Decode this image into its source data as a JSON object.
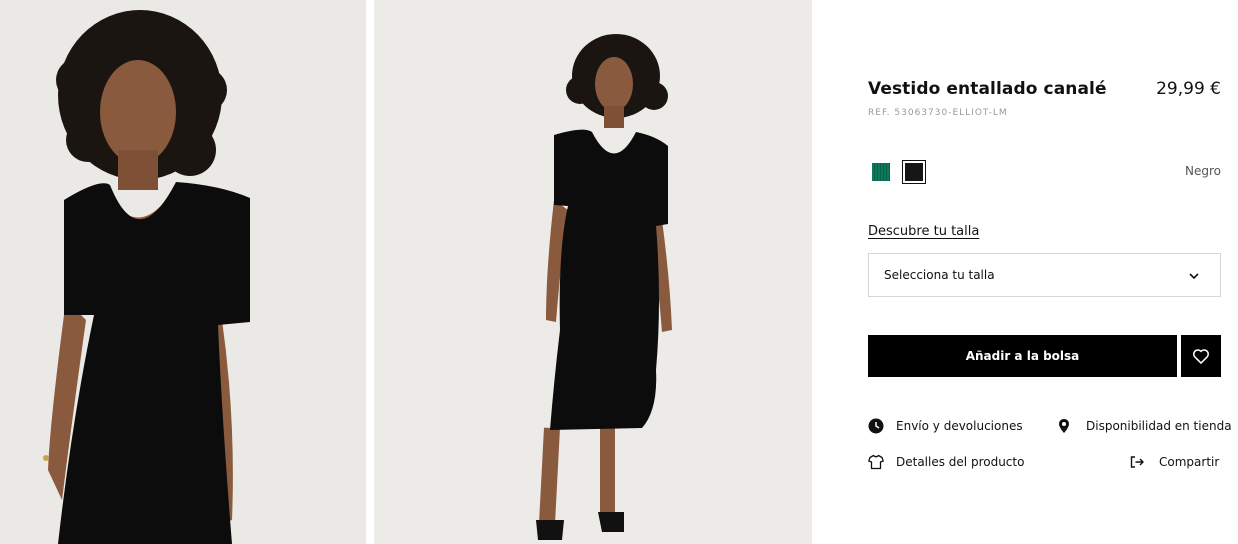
{
  "product": {
    "title": "Vestido entallado canalé",
    "price": "29,99 €",
    "reference": "REF. 53063730-ELLIOT-LM",
    "selected_color": "Negro",
    "colors": [
      {
        "name": "green-swatch",
        "hex": "#0b7a5d"
      },
      {
        "name": "black-swatch",
        "hex": "#161616"
      }
    ]
  },
  "size": {
    "guide_link": "Descubre tu talla",
    "select_label": "Selecciona tu talla"
  },
  "actions": {
    "add_to_bag": "Añadir a la bolsa"
  },
  "links": {
    "shipping": "Envío y devoluciones",
    "store_availability": "Disponibilidad en tienda",
    "details": "Detalles del producto",
    "share": "Compartir"
  },
  "icons": [
    "clock-icon",
    "location-pin-icon",
    "tshirt-icon",
    "share-icon",
    "heart-icon",
    "chevron-down-icon"
  ],
  "colors_ui": {
    "button_bg": "#000000",
    "photo_bg": "#ebe9e5"
  }
}
